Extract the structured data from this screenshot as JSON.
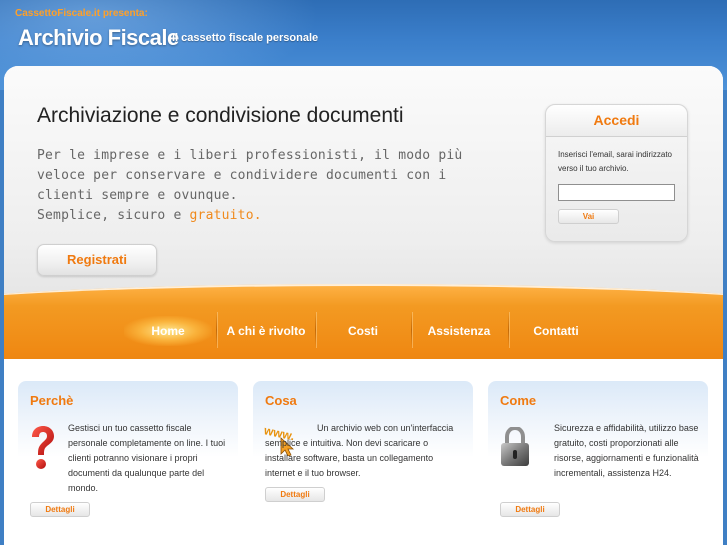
{
  "header": {
    "presenta": "CassettoFiscale.it presenta:",
    "title": "Archivio Fiscale",
    "subtitle": "Il cassetto fiscale personale"
  },
  "hero": {
    "title": "Archiviazione e condivisione documenti",
    "desc_part1": "Per le imprese e i liberi professionisti, il modo più veloce per conservare e condividere documenti con i clienti sempre e ovunque.",
    "desc_part2": "Semplice, sicuro e ",
    "desc_highlight": "gratuito.",
    "register_label": "Registrati"
  },
  "login": {
    "title": "Accedi",
    "text": "Inserisci l'email, sarai indirizzato verso il tuo archivio.",
    "email_value": "",
    "submit_label": "Vai"
  },
  "nav": {
    "items": [
      {
        "label": "Home",
        "active": true
      },
      {
        "label": "A chi è rivolto"
      },
      {
        "label": "Costi"
      },
      {
        "label": "Assistenza"
      },
      {
        "label": "Contatti"
      }
    ]
  },
  "cards": [
    {
      "title": "Perchè",
      "icon": "question-mark-icon",
      "text": "Gestisci un tuo cassetto fiscale personale completamente on line. I tuoi clienti potranno visionare i propri documenti da qualunque parte del mondo.",
      "button": "Dettagli"
    },
    {
      "title": "Cosa",
      "icon": "www-cursor-icon",
      "icon_text": "www.",
      "text": "Un archivio web con un'interfaccia semplice e intuitiva. Non devi scaricare o installare software, basta un collegamento internet e il tuo browser.",
      "button": "Dettagli"
    },
    {
      "title": "Come",
      "icon": "padlock-icon",
      "text": "Sicurezza e affidabilità, utilizzo base gratuito, costi proporzionati alle risorse, aggiornamenti e funzionalità incrementali, assistenza H24.",
      "button": "Dettagli"
    }
  ],
  "colors": {
    "accent": "#f07a10",
    "banner_blue": "#3b7fcb",
    "presenta": "#ffa028"
  }
}
